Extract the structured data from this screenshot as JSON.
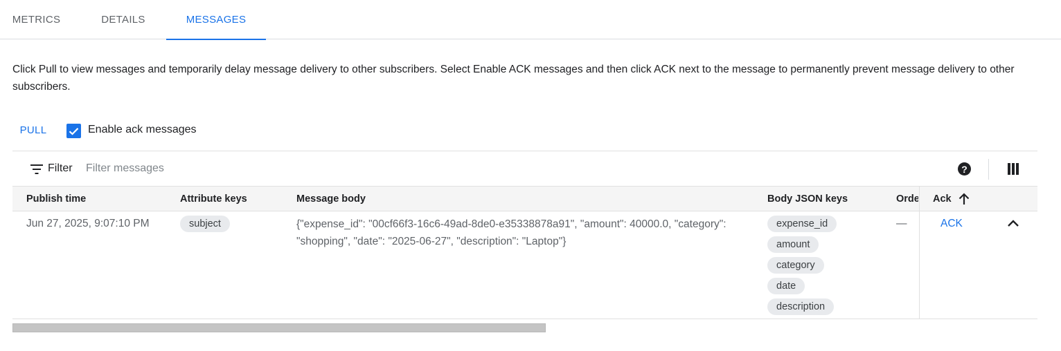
{
  "tabs": [
    {
      "label": "METRICS",
      "active": false
    },
    {
      "label": "DETAILS",
      "active": false
    },
    {
      "label": "MESSAGES",
      "active": true
    }
  ],
  "description": "Click Pull to view messages and temporarily delay message delivery to other subscribers. Select Enable ACK messages and then click ACK next to the message to permanently prevent message delivery to other subscribers.",
  "pull_label": "PULL",
  "enable_ack": {
    "label": "Enable ack messages",
    "checked": true
  },
  "filter": {
    "label": "Filter",
    "placeholder": "Filter messages",
    "icon": "filter-list-icon"
  },
  "toolbar_icons": [
    "help-icon",
    "column-display-icon"
  ],
  "columns": {
    "publish_time": "Publish time",
    "attribute_keys": "Attribute keys",
    "message_body": "Message body",
    "body_json_keys": "Body JSON keys",
    "ordering": "Orde",
    "ack": "Ack"
  },
  "sort": {
    "column": "Ack",
    "direction": "ascending",
    "icon": "arrow-upward-icon"
  },
  "rows": [
    {
      "publish_time": "Jun 27, 2025, 9:07:10 PM",
      "attribute_keys": [
        "subject"
      ],
      "message_body": "{\"expense_id\": \"00cf66f3-16c6-49ad-8de0-e35338878a91\", \"amount\": 40000.0, \"category\": \"shopping\", \"date\": \"2025-06-27\", \"description\": \"Laptop\"}",
      "body_json_keys": [
        "expense_id",
        "amount",
        "category",
        "date",
        "description"
      ],
      "ordering_key": "—",
      "ack_label": "ACK",
      "expanded": true
    }
  ],
  "colors": {
    "accent": "#1a73e8",
    "chip_bg": "#e8eaed",
    "header_bg": "#f5f5f5"
  }
}
